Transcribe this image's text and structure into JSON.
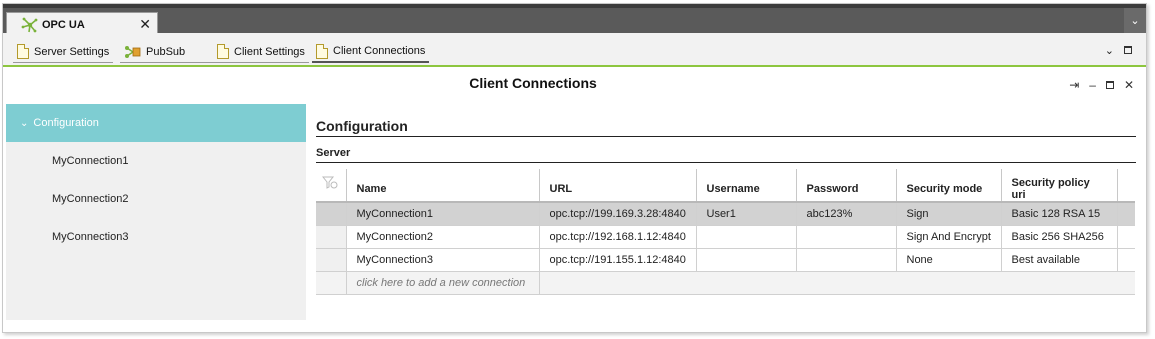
{
  "tab": {
    "title": "OPC UA",
    "close": "✕",
    "icon": "opc-ua-icon"
  },
  "tabbar_overflow": "⌄",
  "toolbar": {
    "items": [
      {
        "label": "Server Settings",
        "icon": "document-icon"
      },
      {
        "label": "PubSub",
        "icon": "pubsub-icon"
      },
      {
        "label": "Client Settings",
        "icon": "document-icon"
      },
      {
        "label": "Client Connections",
        "icon": "document-icon"
      }
    ],
    "menu_glyph": "⌄"
  },
  "view": {
    "title": "Client Connections",
    "pin": "⇥",
    "minimize": "–",
    "close": "✕"
  },
  "nav": {
    "root": {
      "label": "Configuration",
      "chevron": "⌄"
    },
    "items": [
      "MyConnection1",
      "MyConnection2",
      "MyConnection3"
    ]
  },
  "main": {
    "section_title": "Configuration",
    "subsection_title": "Server",
    "table": {
      "columns": [
        "Name",
        "URL",
        "Username",
        "Password",
        "Security mode",
        "Security policy uri"
      ],
      "rows": [
        [
          "MyConnection1",
          "opc.tcp://199.169.3.28:4840",
          "User1",
          "abc123%",
          "Sign",
          "Basic 128 RSA 15"
        ],
        [
          "MyConnection2",
          "opc.tcp://192.168.1.12:4840",
          "",
          "",
          "Sign And Encrypt",
          "Basic 256 SHA256"
        ],
        [
          "MyConnection3",
          "opc.tcp://191.155.1.12:4840",
          "",
          "",
          "None",
          "Best available"
        ]
      ],
      "add_row_placeholder": "click here to add a new connection"
    }
  },
  "colors": {
    "accent_green": "#8dc63f",
    "nav_selected": "#7ecdd2",
    "row_selected": "#d2d2d2",
    "tabbar": "#5a5a5a"
  }
}
